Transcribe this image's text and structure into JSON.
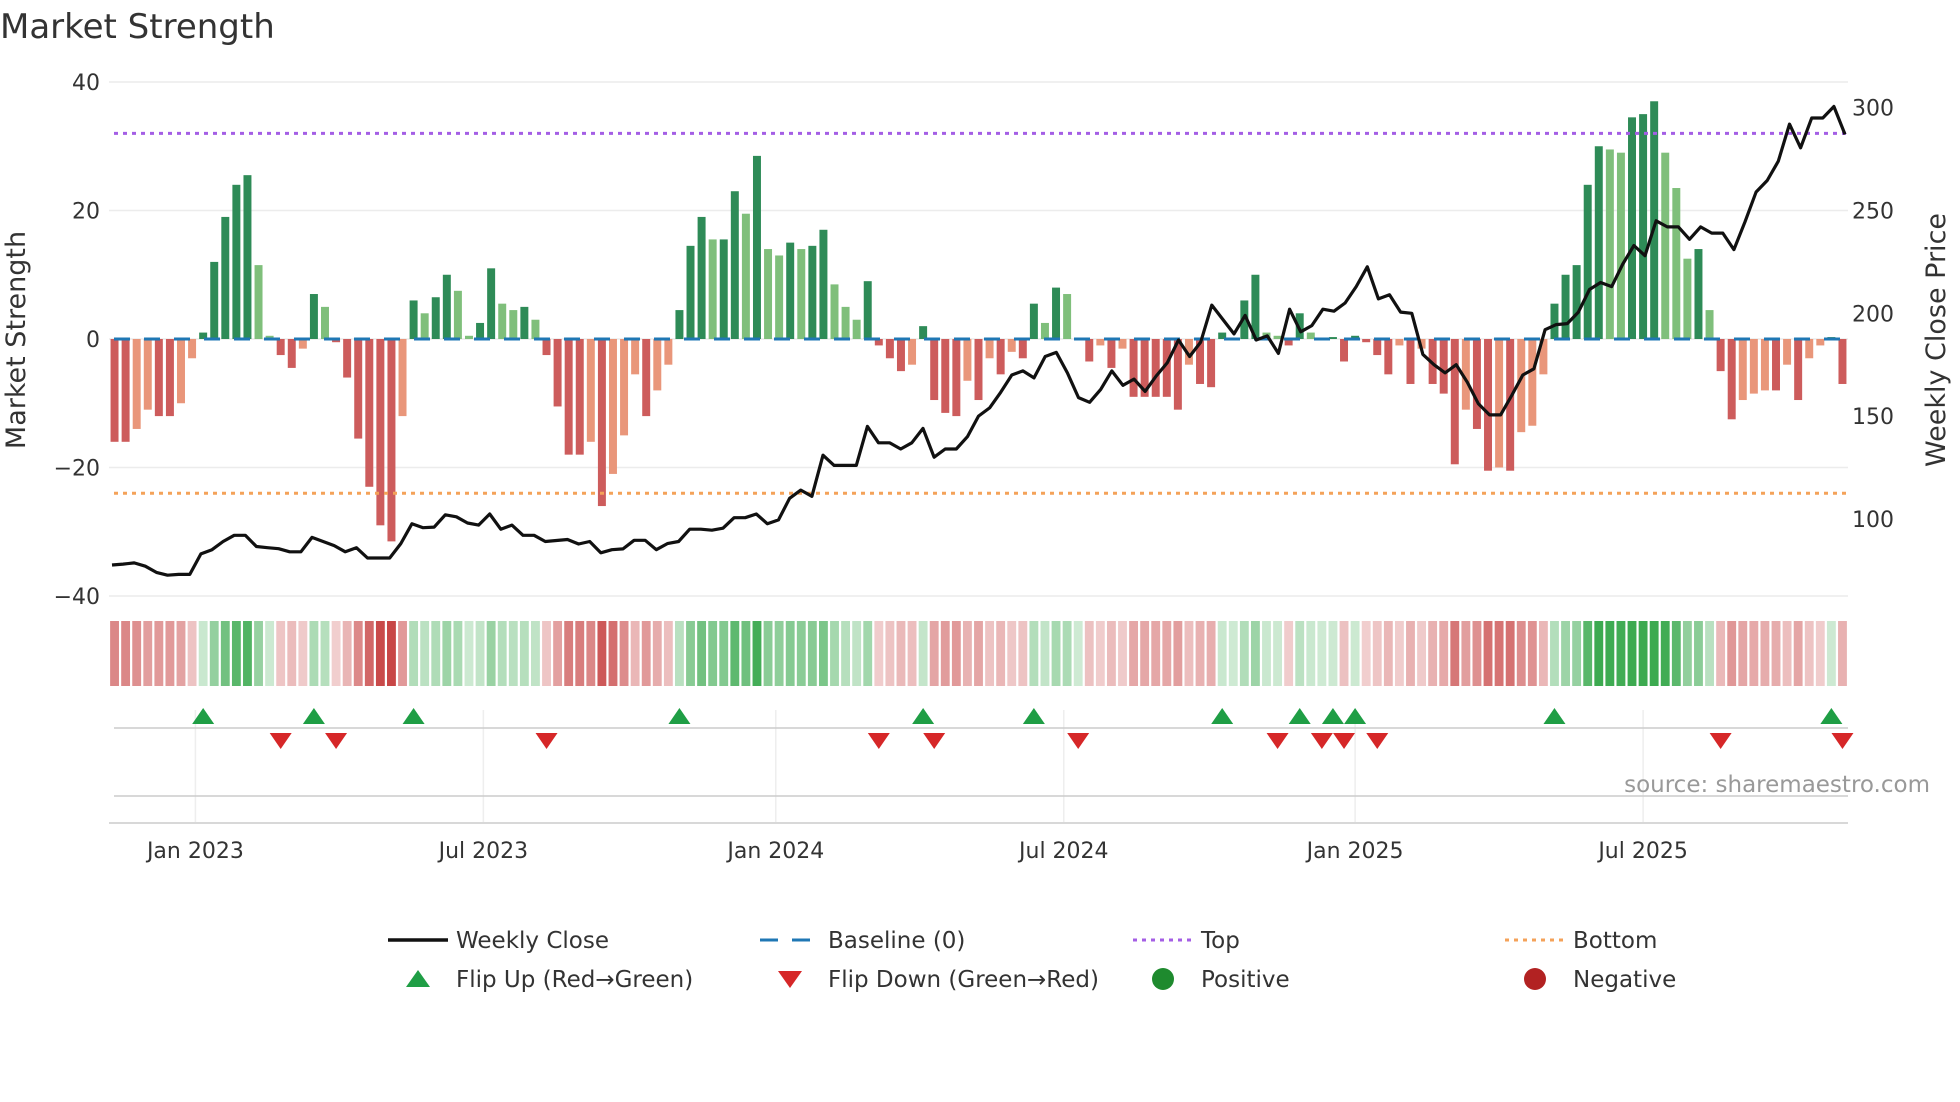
{
  "chart_data": {
    "type": "bar",
    "title": "Market Strength",
    "ylabel": "Market Strength",
    "y2label": "Weekly Close Price",
    "ylim": [
      -40,
      40
    ],
    "y2lim": [
      62.5,
      312.5
    ],
    "yticks": [
      "40",
      "20",
      "0",
      "−20",
      "−40"
    ],
    "ytick_values": [
      40,
      20,
      0,
      -20,
      -40
    ],
    "y2ticks": [
      "300",
      "250",
      "200",
      "150",
      "100"
    ],
    "y2tick_values": [
      300,
      250,
      200,
      150,
      100
    ],
    "x_start_date": "2022-11-14",
    "x_frequency": "weekly",
    "xticks": [
      {
        "label": "Jan 2023",
        "week": 7.3
      },
      {
        "label": "Jul 2023",
        "week": 33.3
      },
      {
        "label": "Jan 2024",
        "week": 59.7
      },
      {
        "label": "Jul 2024",
        "week": 85.7
      },
      {
        "label": "Jan 2025",
        "week": 112
      },
      {
        "label": "Jul 2025",
        "week": 138
      }
    ],
    "top_level": 32,
    "bottom_level": -24,
    "baseline": 0,
    "strength": [
      -16,
      -16,
      -14,
      -11,
      -12,
      -12,
      -10,
      -3,
      1,
      12,
      19,
      24,
      25.5,
      11.5,
      0.5,
      -2.5,
      -4.5,
      -1.5,
      7,
      5,
      -0.5,
      -6,
      -15.5,
      -23,
      -29,
      -31.5,
      -12,
      6,
      4,
      6.5,
      10,
      7.5,
      0.5,
      2.5,
      11,
      5.5,
      4.5,
      5,
      3,
      -2.5,
      -10.5,
      -18,
      -18,
      -16,
      -26,
      -21,
      -15,
      -5.5,
      -12,
      -8,
      -4,
      4.5,
      14.5,
      19,
      15.5,
      15.5,
      23,
      19.5,
      28.5,
      14,
      13,
      15,
      14,
      14.5,
      17,
      8.5,
      5,
      3,
      9,
      -1,
      -3,
      -5,
      -4,
      2,
      -9.5,
      -11.5,
      -12,
      -6.5,
      -9.5,
      -3,
      -5.5,
      -2,
      -3,
      5.5,
      2.5,
      8,
      7,
      0,
      -3.5,
      -1,
      -4.5,
      -1.5,
      -9,
      -9,
      -9,
      -9,
      -11,
      -4,
      -7,
      -7.5,
      1,
      0,
      6,
      10,
      1,
      0.5,
      -1,
      4,
      1,
      0,
      0.3,
      -3.5,
      0.5,
      -0.5,
      -2.5,
      -5.5,
      -1,
      -7,
      -1.5,
      -7,
      -8.5,
      -19.5,
      -11,
      -14,
      -20.5,
      -20,
      -20.5,
      -14.5,
      -13.5,
      -5.5,
      5.5,
      10,
      11.5,
      24,
      30,
      29.5,
      29,
      34.5,
      35,
      37,
      29,
      23.5,
      12.5,
      14,
      4.5,
      -5,
      -12.5,
      -9.5,
      -8.5,
      -8,
      -8,
      -4,
      -9.5,
      -3,
      -1,
      0.3,
      -7
    ],
    "close": [
      77.6,
      78,
      78.6,
      77,
      74,
      72.6,
      73,
      73,
      83,
      85,
      89,
      92,
      92,
      86.6,
      86,
      85.5,
      84,
      84,
      91,
      89,
      87,
      84,
      86,
      81,
      81,
      81,
      88,
      97.6,
      95.7,
      96,
      102,
      101,
      98,
      97,
      102.4,
      95,
      97,
      92,
      92,
      89,
      89.5,
      90,
      87.8,
      89,
      83.5,
      85,
      85.4,
      89.6,
      89.6,
      85,
      88,
      89,
      95,
      95,
      94.5,
      95.5,
      100.6,
      100.6,
      102.4,
      97.6,
      99.5,
      110,
      114,
      111,
      131,
      126,
      126,
      126,
      145,
      137,
      137,
      134,
      137,
      144,
      130,
      134,
      134,
      140,
      150,
      154,
      161.6,
      170,
      172,
      168.6,
      179,
      181,
      171,
      159,
      156.7,
      163,
      172,
      165,
      168,
      162,
      169.5,
      176,
      187,
      179,
      186,
      204,
      197,
      190,
      199,
      187,
      189,
      180.5,
      202,
      191,
      194,
      202,
      201,
      205,
      213,
      222.6,
      207,
      209,
      200.6,
      200,
      180,
      175,
      171,
      175,
      166.5,
      156,
      150.6,
      150.6,
      160,
      170,
      173,
      192,
      194.5,
      195,
      200.6,
      211.6,
      215,
      213,
      224,
      233,
      228,
      245,
      242,
      242,
      236,
      242,
      239,
      239,
      231,
      244.5,
      259,
      264.6,
      274,
      292,
      280.5,
      295,
      295,
      300.6,
      287
    ],
    "flip_up_weeks": [
      8,
      18,
      27,
      51,
      73,
      83,
      100,
      107,
      110,
      112,
      130,
      155
    ],
    "flip_down_weeks": [
      15,
      20,
      39,
      69,
      74,
      87,
      105,
      109,
      111,
      114,
      145,
      156
    ],
    "legend": {
      "placement": "bottom",
      "items": [
        {
          "label": "Weekly Close",
          "symbol": "line",
          "color": "#111111"
        },
        {
          "label": "Baseline (0)",
          "symbol": "dash",
          "color": "#1f77b4"
        },
        {
          "label": "Top",
          "symbol": "dot",
          "color": "#a45ee5"
        },
        {
          "label": "Bottom",
          "symbol": "dot",
          "color": "#f4a259"
        },
        {
          "label": "Flip Up (Red→Green)",
          "symbol": "triangle-up",
          "color": "#1f9e45"
        },
        {
          "label": "Flip Down (Green→Red)",
          "symbol": "triangle-down",
          "color": "#d62728"
        },
        {
          "label": "Positive",
          "symbol": "circle",
          "color": "#1e8a2e"
        },
        {
          "label": "Negative",
          "symbol": "circle",
          "color": "#b22222"
        }
      ]
    },
    "colors": {
      "pos_rising": "#2e8b57",
      "pos_falling": "#7fbf7b",
      "neg_falling": "#cd5c5c",
      "neg_rising": "#e9967a"
    },
    "source": "source: sharemaestro.com"
  }
}
